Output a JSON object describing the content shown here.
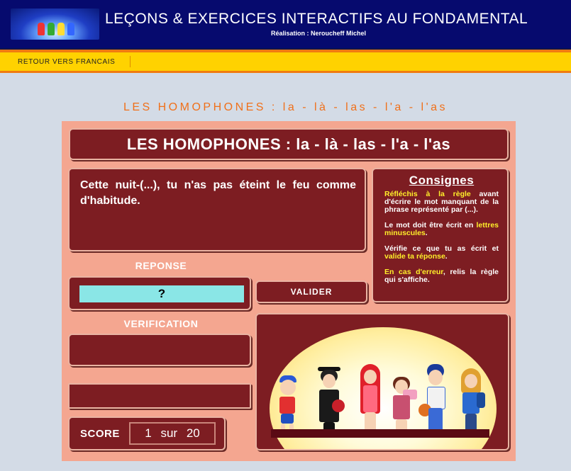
{
  "header": {
    "title": "LEÇONS & EXERCICES INTERACTIFS AU FONDAMENTAL",
    "credit": "Réalisation : Neroucheff Michel"
  },
  "nav": {
    "back_link": "RETOUR VERS FRANCAIS"
  },
  "page": {
    "heading": "LES HOMOPHONES : la - là - las - l'a - l'as"
  },
  "exercise": {
    "title": "LES HOMOPHONES : la - là - las - l'a - l'as",
    "question": "Cette nuit-(...), tu n'as pas éteint le feu comme d'habitude.",
    "reponse_label": "REPONSE",
    "answer_value": "?",
    "valider_label": "VALIDER",
    "verification_label": "VERIFICATION",
    "verification_text": "",
    "rule_text": "",
    "score_label": "SCORE",
    "score_current": "1",
    "score_sep": "sur",
    "score_total": "20"
  },
  "consignes": {
    "title": "Consignes",
    "p1_hl": "Réfléchis à la règle",
    "p1_rest": " avant d'écrire le mot manquant de la phrase représenté par (...).",
    "p2_start": "Le mot doit être écrit en ",
    "p2_hl": "lettres minuscules",
    "p2_end": ".",
    "p3_start": "Vérifie ce que tu as écrit et ",
    "p3_hl": "valide ta réponse",
    "p3_end": ".",
    "p4_hl": "En cas d'erreur",
    "p4_rest": ", relis la règle qui s'affiche."
  },
  "colors": {
    "header_bg": "#060a6e",
    "nav_bg": "#ffd200",
    "accent_orange": "#f07b10",
    "panel_bg": "#f4a690",
    "box_bg": "#7d1d22",
    "answer_bg": "#8ae6e6",
    "highlight": "#ffef2a"
  }
}
